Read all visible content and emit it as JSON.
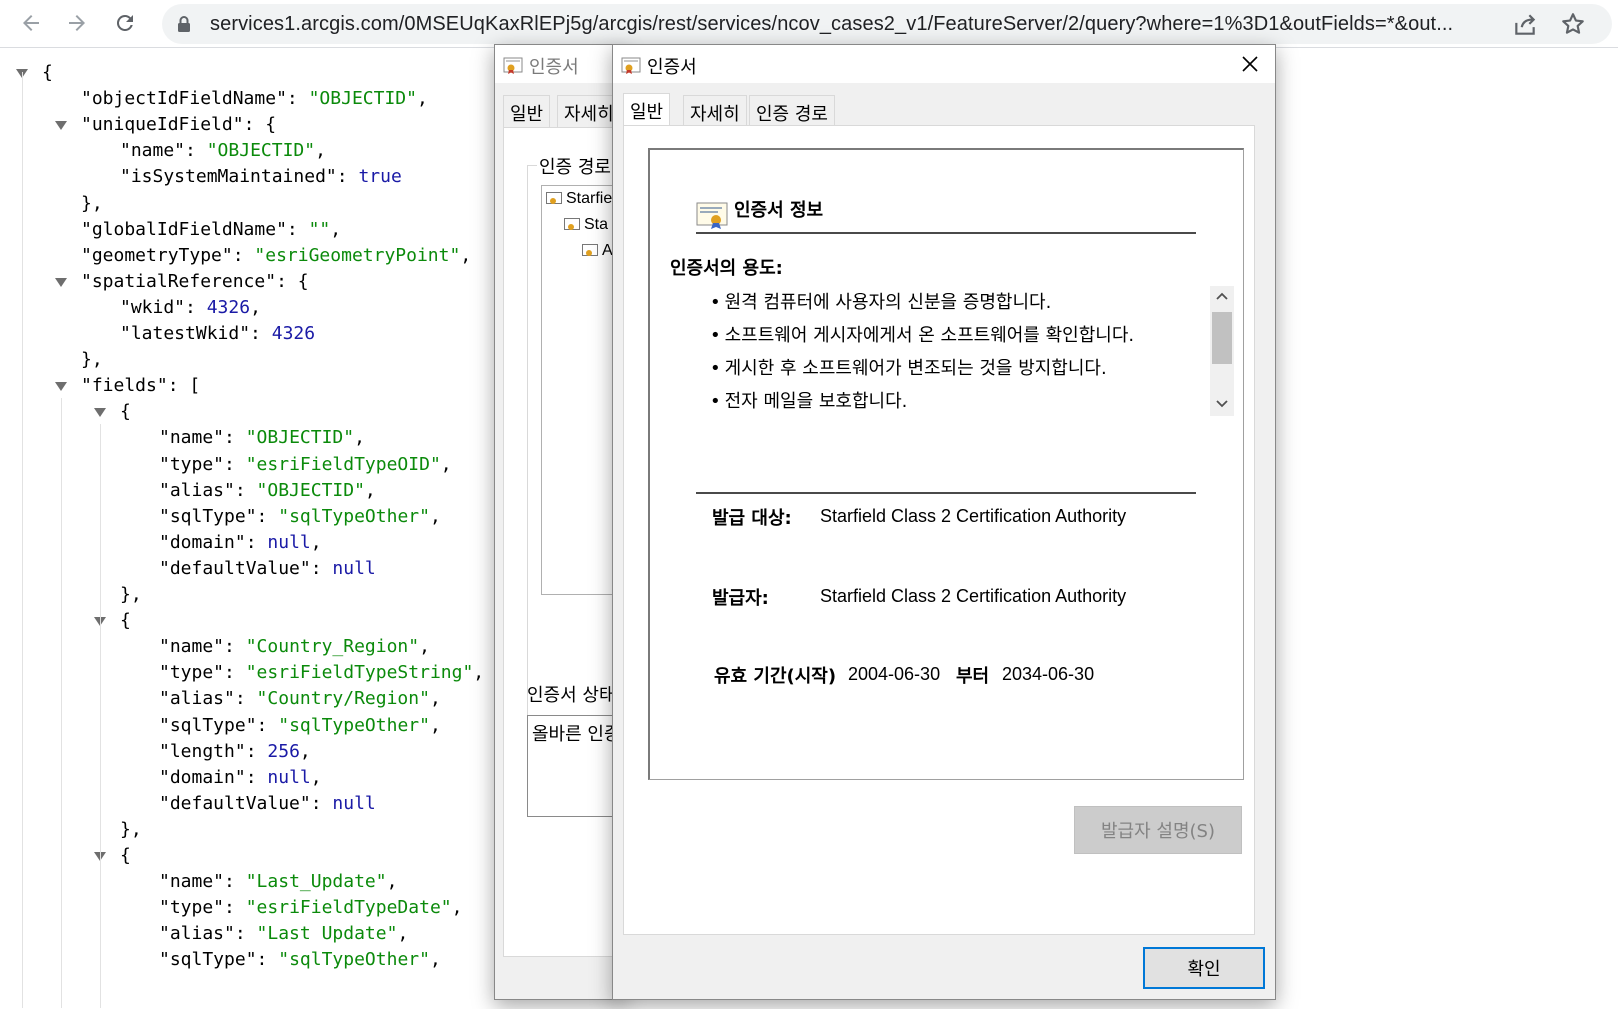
{
  "browser": {
    "url": "services1.arcgis.com/0MSEUqKaxRlEPj5g/arcgis/rest/services/ncov_cases2_v1/FeatureServer/2/query?where=1%3D1&outFields=*&out..."
  },
  "json_viewer": {
    "lines": [
      {
        "indent": 1,
        "toggle": true,
        "tokens": [
          {
            "t": "p",
            "v": "{"
          }
        ]
      },
      {
        "indent": 2,
        "tokens": [
          {
            "t": "k",
            "v": "\"objectIdFieldName\""
          },
          {
            "t": "p",
            "v": ": "
          },
          {
            "t": "s",
            "v": "\"OBJECTID\""
          },
          {
            "t": "p",
            "v": ","
          }
        ]
      },
      {
        "indent": 2,
        "toggle": true,
        "tokens": [
          {
            "t": "k",
            "v": "\"uniqueIdField\""
          },
          {
            "t": "p",
            "v": ": {"
          }
        ]
      },
      {
        "indent": 3,
        "tokens": [
          {
            "t": "k",
            "v": "\"name\""
          },
          {
            "t": "p",
            "v": ": "
          },
          {
            "t": "s",
            "v": "\"OBJECTID\""
          },
          {
            "t": "p",
            "v": ","
          }
        ]
      },
      {
        "indent": 3,
        "tokens": [
          {
            "t": "k",
            "v": "\"isSystemMaintained\""
          },
          {
            "t": "p",
            "v": ": "
          },
          {
            "t": "w",
            "v": "true"
          }
        ]
      },
      {
        "indent": 2,
        "tokens": [
          {
            "t": "p",
            "v": "},"
          }
        ]
      },
      {
        "indent": 2,
        "tokens": [
          {
            "t": "k",
            "v": "\"globalIdFieldName\""
          },
          {
            "t": "p",
            "v": ": "
          },
          {
            "t": "s",
            "v": "\"\""
          },
          {
            "t": "p",
            "v": ","
          }
        ]
      },
      {
        "indent": 2,
        "tokens": [
          {
            "t": "k",
            "v": "\"geometryType\""
          },
          {
            "t": "p",
            "v": ": "
          },
          {
            "t": "s",
            "v": "\"esriGeometryPoint\""
          },
          {
            "t": "p",
            "v": ","
          }
        ]
      },
      {
        "indent": 2,
        "toggle": true,
        "tokens": [
          {
            "t": "k",
            "v": "\"spatialReference\""
          },
          {
            "t": "p",
            "v": ": {"
          }
        ]
      },
      {
        "indent": 3,
        "tokens": [
          {
            "t": "k",
            "v": "\"wkid\""
          },
          {
            "t": "p",
            "v": ": "
          },
          {
            "t": "n",
            "v": "4326"
          },
          {
            "t": "p",
            "v": ","
          }
        ]
      },
      {
        "indent": 3,
        "tokens": [
          {
            "t": "k",
            "v": "\"latestWkid\""
          },
          {
            "t": "p",
            "v": ": "
          },
          {
            "t": "n",
            "v": "4326"
          }
        ]
      },
      {
        "indent": 2,
        "tokens": [
          {
            "t": "p",
            "v": "},"
          }
        ]
      },
      {
        "indent": 2,
        "toggle": true,
        "tokens": [
          {
            "t": "k",
            "v": "\"fields\""
          },
          {
            "t": "p",
            "v": ": ["
          }
        ]
      },
      {
        "indent": 3,
        "toggle": true,
        "tokens": [
          {
            "t": "p",
            "v": "{"
          }
        ]
      },
      {
        "indent": 4,
        "tokens": [
          {
            "t": "k",
            "v": "\"name\""
          },
          {
            "t": "p",
            "v": ": "
          },
          {
            "t": "s",
            "v": "\"OBJECTID\""
          },
          {
            "t": "p",
            "v": ","
          }
        ]
      },
      {
        "indent": 4,
        "tokens": [
          {
            "t": "k",
            "v": "\"type\""
          },
          {
            "t": "p",
            "v": ": "
          },
          {
            "t": "s",
            "v": "\"esriFieldTypeOID\""
          },
          {
            "t": "p",
            "v": ","
          }
        ]
      },
      {
        "indent": 4,
        "tokens": [
          {
            "t": "k",
            "v": "\"alias\""
          },
          {
            "t": "p",
            "v": ": "
          },
          {
            "t": "s",
            "v": "\"OBJECTID\""
          },
          {
            "t": "p",
            "v": ","
          }
        ]
      },
      {
        "indent": 4,
        "tokens": [
          {
            "t": "k",
            "v": "\"sqlType\""
          },
          {
            "t": "p",
            "v": ": "
          },
          {
            "t": "s",
            "v": "\"sqlTypeOther\""
          },
          {
            "t": "p",
            "v": ","
          }
        ]
      },
      {
        "indent": 4,
        "tokens": [
          {
            "t": "k",
            "v": "\"domain\""
          },
          {
            "t": "p",
            "v": ": "
          },
          {
            "t": "w",
            "v": "null"
          },
          {
            "t": "p",
            "v": ","
          }
        ]
      },
      {
        "indent": 4,
        "tokens": [
          {
            "t": "k",
            "v": "\"defaultValue\""
          },
          {
            "t": "p",
            "v": ": "
          },
          {
            "t": "w",
            "v": "null"
          }
        ]
      },
      {
        "indent": 3,
        "tokens": [
          {
            "t": "p",
            "v": "},"
          }
        ]
      },
      {
        "indent": 3,
        "toggle": true,
        "tokens": [
          {
            "t": "p",
            "v": "{"
          }
        ]
      },
      {
        "indent": 4,
        "tokens": [
          {
            "t": "k",
            "v": "\"name\""
          },
          {
            "t": "p",
            "v": ": "
          },
          {
            "t": "s",
            "v": "\"Country_Region\""
          },
          {
            "t": "p",
            "v": ","
          }
        ]
      },
      {
        "indent": 4,
        "tokens": [
          {
            "t": "k",
            "v": "\"type\""
          },
          {
            "t": "p",
            "v": ": "
          },
          {
            "t": "s",
            "v": "\"esriFieldTypeString\""
          },
          {
            "t": "p",
            "v": ","
          }
        ]
      },
      {
        "indent": 4,
        "tokens": [
          {
            "t": "k",
            "v": "\"alias\""
          },
          {
            "t": "p",
            "v": ": "
          },
          {
            "t": "s",
            "v": "\"Country/Region\""
          },
          {
            "t": "p",
            "v": ","
          }
        ]
      },
      {
        "indent": 4,
        "tokens": [
          {
            "t": "k",
            "v": "\"sqlType\""
          },
          {
            "t": "p",
            "v": ": "
          },
          {
            "t": "s",
            "v": "\"sqlTypeOther\""
          },
          {
            "t": "p",
            "v": ","
          }
        ]
      },
      {
        "indent": 4,
        "tokens": [
          {
            "t": "k",
            "v": "\"length\""
          },
          {
            "t": "p",
            "v": ": "
          },
          {
            "t": "n",
            "v": "256"
          },
          {
            "t": "p",
            "v": ","
          }
        ]
      },
      {
        "indent": 4,
        "tokens": [
          {
            "t": "k",
            "v": "\"domain\""
          },
          {
            "t": "p",
            "v": ": "
          },
          {
            "t": "w",
            "v": "null"
          },
          {
            "t": "p",
            "v": ","
          }
        ]
      },
      {
        "indent": 4,
        "tokens": [
          {
            "t": "k",
            "v": "\"defaultValue\""
          },
          {
            "t": "p",
            "v": ": "
          },
          {
            "t": "w",
            "v": "null"
          }
        ]
      },
      {
        "indent": 3,
        "tokens": [
          {
            "t": "p",
            "v": "},"
          }
        ]
      },
      {
        "indent": 3,
        "toggle": true,
        "tokens": [
          {
            "t": "p",
            "v": "{"
          }
        ]
      },
      {
        "indent": 4,
        "tokens": [
          {
            "t": "k",
            "v": "\"name\""
          },
          {
            "t": "p",
            "v": ": "
          },
          {
            "t": "s",
            "v": "\"Last_Update\""
          },
          {
            "t": "p",
            "v": ","
          }
        ]
      },
      {
        "indent": 4,
        "tokens": [
          {
            "t": "k",
            "v": "\"type\""
          },
          {
            "t": "p",
            "v": ": "
          },
          {
            "t": "s",
            "v": "\"esriFieldTypeDate\""
          },
          {
            "t": "p",
            "v": ","
          }
        ]
      },
      {
        "indent": 4,
        "tokens": [
          {
            "t": "k",
            "v": "\"alias\""
          },
          {
            "t": "p",
            "v": ": "
          },
          {
            "t": "s",
            "v": "\"Last Update\""
          },
          {
            "t": "p",
            "v": ","
          }
        ]
      },
      {
        "indent": 4,
        "tokens": [
          {
            "t": "k",
            "v": "\"sqlType\""
          },
          {
            "t": "p",
            "v": ": "
          },
          {
            "t": "s",
            "v": "\"sqlTypeOther\""
          },
          {
            "t": "p",
            "v": ","
          }
        ]
      }
    ]
  },
  "back_dialog": {
    "title": "인증서",
    "tabs": [
      "일반",
      "자세히"
    ],
    "path_group_label": "인증 경로",
    "tree": [
      "Starfie",
      "Sta",
      "A"
    ],
    "status_label": "인증서 상태",
    "status_text": "올바른 인증"
  },
  "cert_dialog": {
    "title": "인증서",
    "tabs": [
      "일반",
      "자세히",
      "인증 경로"
    ],
    "info_header": "인증서 정보",
    "purpose_title": "인증서의 용도:",
    "purposes": [
      "원격 컴퓨터에 사용자의 신분을 증명합니다.",
      "소프트웨어 게시자에게서 온 소프트웨어를 확인합니다.",
      "게시한 후 소프트웨어가 변조되는 것을 방지합니다.",
      "전자 메일을 보호합니다."
    ],
    "issued_to_label": "발급 대상:",
    "issued_to": "Starfield Class 2 Certification Authority",
    "issued_by_label": "발급자:",
    "issued_by": "Starfield Class 2 Certification Authority",
    "valid_label": "유효 기간(시작)",
    "valid_from": "2004-06-30",
    "valid_mid": "부터",
    "valid_to": "2034-06-30",
    "issuer_statement_button": "발급자 설명(S)",
    "ok_button": "확인"
  },
  "colors": {
    "json_string": "#0b8a0b",
    "json_number": "#1a1aa6",
    "ok_border": "#0078d7"
  },
  "icons": [
    "back-arrow-icon",
    "forward-arrow-icon",
    "reload-icon",
    "lock-icon",
    "share-icon",
    "star-icon",
    "certificate-icon",
    "close-icon",
    "scroll-up-icon",
    "scroll-down-icon"
  ]
}
